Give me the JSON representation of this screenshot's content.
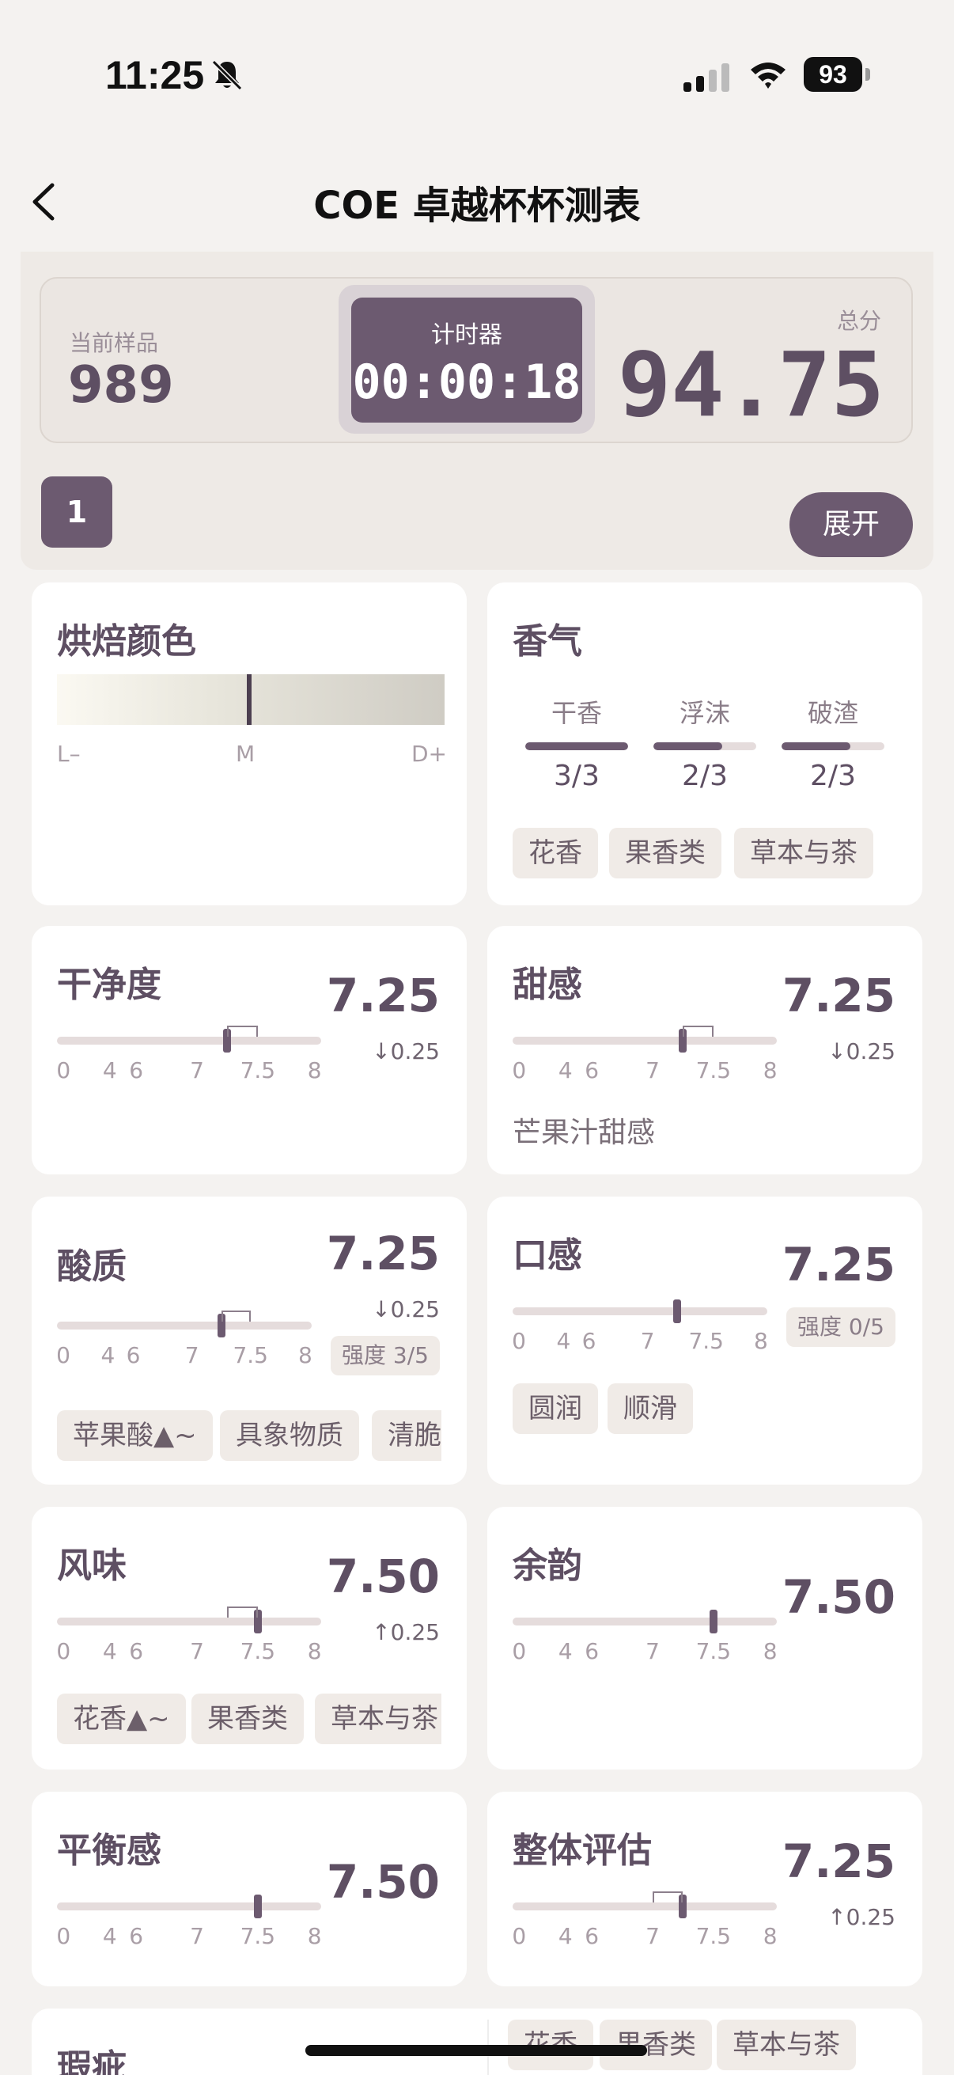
{
  "status": {
    "time": "11:25",
    "battery": "93"
  },
  "nav": {
    "title": "COE 卓越杯杯测表"
  },
  "summary": {
    "sample_label": "当前样品",
    "sample_value": "989",
    "timer_label": "计时器",
    "timer_value": "00:00:18",
    "total_label": "总分",
    "total_value": "94.75",
    "sample_index": "1",
    "expand_label": "展开"
  },
  "ticks": [
    "0",
    "4",
    "6",
    "7",
    "7.5",
    "8"
  ],
  "roast": {
    "title": "烘焙颜色",
    "labels": [
      "L–",
      "M",
      "D+"
    ]
  },
  "aroma": {
    "title": "香气",
    "cols": [
      {
        "name": "干香",
        "value": "3/3",
        "level": 1.0
      },
      {
        "name": "浮沫",
        "value": "2/3",
        "level": 0.667
      },
      {
        "name": "破渣",
        "value": "2/3",
        "level": 0.667
      }
    ],
    "tags": [
      "花香",
      "果香类",
      "草本与茶"
    ]
  },
  "cards": {
    "clean": {
      "title": "干净度",
      "score": "7.25",
      "delta": "↓0.25",
      "value": 7.25
    },
    "sweet": {
      "title": "甜感",
      "score": "7.25",
      "delta": "↓0.25",
      "note": "芒果汁甜感",
      "value": 7.25
    },
    "acid": {
      "title": "酸质",
      "score": "7.25",
      "delta": "↓0.25",
      "intensity": "强度 3/5",
      "tags": [
        "苹果酸▲~",
        "具象物质",
        "清脆"
      ],
      "value": 7.25
    },
    "mouth": {
      "title": "口感",
      "score": "7.25",
      "intensity": "强度 0/5",
      "tags": [
        "圆润",
        "顺滑"
      ],
      "value": 7.25
    },
    "flavor": {
      "title": "风味",
      "score": "7.50",
      "delta": "↑0.25",
      "tags": [
        "花香▲~",
        "果香类",
        "草本与茶"
      ],
      "value": 7.5
    },
    "after": {
      "title": "余韵",
      "score": "7.50",
      "value": 7.5
    },
    "balance": {
      "title": "平衡感",
      "score": "7.50",
      "value": 7.5
    },
    "overall": {
      "title": "整体评估",
      "score": "7.25",
      "delta": "↑0.25",
      "value": 7.25
    },
    "defect": {
      "title": "瑕疵",
      "tags": [
        "花香",
        "果香类",
        "草本与茶"
      ]
    }
  }
}
